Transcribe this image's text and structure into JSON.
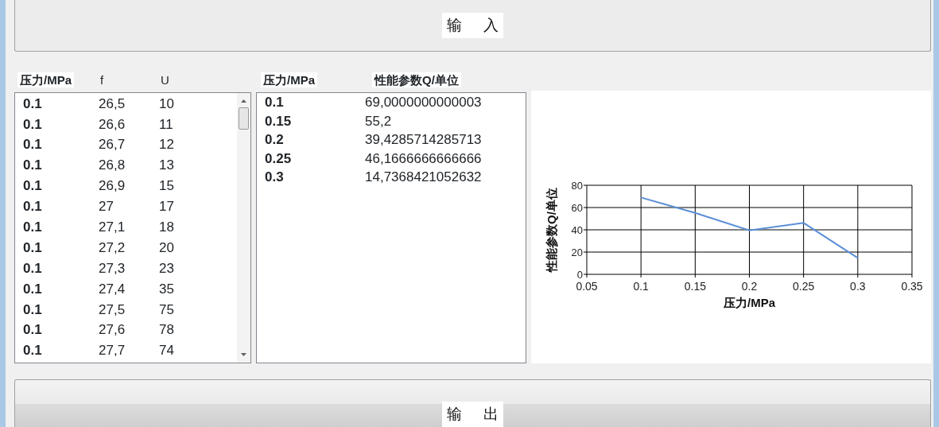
{
  "input_button": {
    "label": "输     入"
  },
  "input_table": {
    "columns": [
      "压力/MPa",
      "f",
      "U"
    ],
    "rows": [
      [
        "0.1",
        "26,5",
        "10"
      ],
      [
        "0.1",
        "26,6",
        "11"
      ],
      [
        "0.1",
        "26,7",
        "12"
      ],
      [
        "0.1",
        "26,8",
        "13"
      ],
      [
        "0.1",
        "26,9",
        "15"
      ],
      [
        "0.1",
        "27",
        "17"
      ],
      [
        "0.1",
        "27,1",
        "18"
      ],
      [
        "0.1",
        "27,2",
        "20"
      ],
      [
        "0.1",
        "27,3",
        "23"
      ],
      [
        "0.1",
        "27,4",
        "35"
      ],
      [
        "0.1",
        "27,5",
        "75"
      ],
      [
        "0.1",
        "27,6",
        "78"
      ],
      [
        "0.1",
        "27,7",
        "74"
      ]
    ]
  },
  "result_table": {
    "columns": [
      "压力/MPa",
      "性能参数Q/单位"
    ],
    "rows": [
      [
        "0.1",
        "69,0000000000003"
      ],
      [
        "0.15",
        "55,2"
      ],
      [
        "0.2",
        "39,4285714285713"
      ],
      [
        "0.25",
        "46,1666666666666"
      ],
      [
        "0.3",
        "14,7368421052632"
      ]
    ]
  },
  "chart": {
    "chart_data": {
      "type": "line",
      "xlabel": "压力/MPa",
      "ylabel": "性能参数Q/单位",
      "x": [
        0.1,
        0.15,
        0.2,
        0.25,
        0.3
      ],
      "series": [
        {
          "color": "#5b8fd6",
          "values": [
            69,
            55.2,
            39.4,
            46.2,
            14.7
          ]
        }
      ],
      "grid": true,
      "xlim": [
        0.05,
        0.35
      ],
      "ylim": [
        0,
        80
      ],
      "xticks": [
        0.05,
        0.1,
        0.15,
        0.2,
        0.25,
        0.3,
        0.35
      ],
      "yticks": [
        0,
        20,
        40,
        60,
        80
      ]
    }
  },
  "output_button": {
    "label": "输     出"
  }
}
